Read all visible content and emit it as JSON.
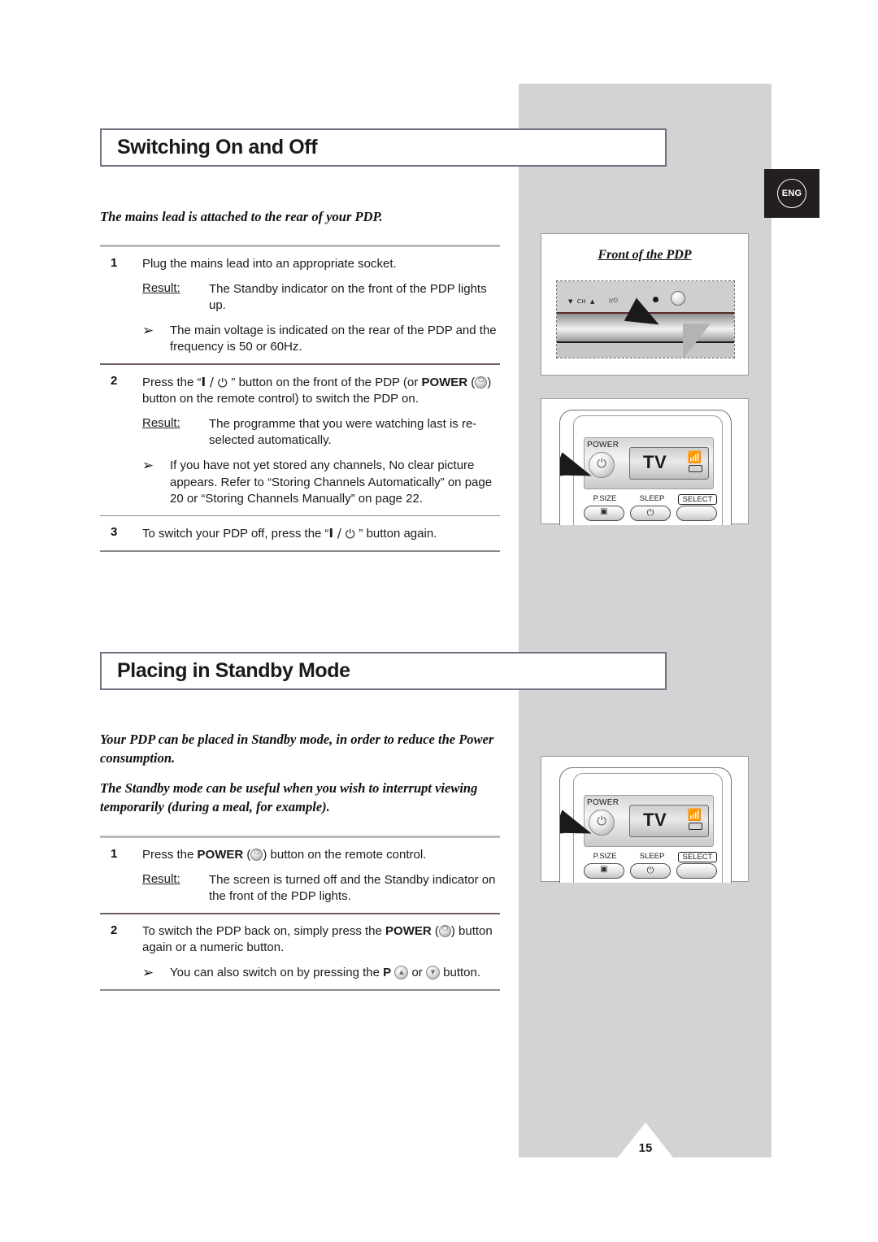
{
  "page": {
    "number": "15",
    "language_badge": "ENG"
  },
  "sections": [
    {
      "heading": "Switching On and Off",
      "intro": "The mains lead is attached to the rear of your PDP.",
      "steps": [
        {
          "num": "1",
          "text": "Plug the mains lead into an appropriate socket.",
          "result_label": "Result:",
          "result_text": "The Standby indicator on the front of the PDP lights up.",
          "note": "The main voltage is indicated on the rear of the PDP and the frequency is 50 or 60Hz."
        },
        {
          "num": "2",
          "text_a": "Press the “",
          "text_b": "” button on the front of the PDP (or ",
          "keyword": "POWER",
          "text_c": ") button on the remote control) to switch the PDP on.",
          "result_label": "Result:",
          "result_text": "The programme that you were watching last is re-selected automatically.",
          "note": "If you have not yet stored any channels, No clear picture appears. Refer to “Storing Channels Automatically” on page 20 or “Storing Channels Manually” on page 22."
        },
        {
          "num": "3",
          "text_a": "To switch your PDP off, press the “",
          "text_b": "” button again."
        }
      ]
    },
    {
      "heading": "Placing in Standby Mode",
      "intro_1": "Your PDP can be placed in Standby mode, in order to reduce the Power consumption.",
      "intro_2": "The Standby mode can be useful when you wish to interrupt viewing temporarily (during a meal, for example).",
      "steps": [
        {
          "num": "1",
          "text_a": "Press the ",
          "keyword": "POWER",
          "text_b": ") button on the remote control.",
          "result_label": "Result:",
          "result_text": "The screen is turned off and the Standby indicator on the front of the PDP lights."
        },
        {
          "num": "2",
          "text_a": "To switch the PDP back on, simply press the ",
          "keyword": "POWER",
          "text_b": ") button again or a numeric button.",
          "note_a": "You can also switch on by pressing the ",
          "note_keyword": "P",
          "note_b": " or ",
          "note_c": " button."
        }
      ]
    }
  ],
  "figures": {
    "front_of_pdp": {
      "title": "Front of the PDP",
      "controls": {
        "down_arrow": "▼",
        "ch_label": "CH",
        "up_arrow": "▲",
        "power_label": "I/⏻"
      }
    },
    "remote": {
      "power_label": "POWER",
      "display_text": "TV",
      "keys": [
        {
          "label": "P.SIZE",
          "glyph": "▣"
        },
        {
          "label": "SLEEP",
          "glyph": "⏻"
        },
        {
          "label": "SELECT",
          "glyph": ""
        }
      ]
    }
  },
  "glyphs": {
    "io_bar": "I",
    "io_slash": "/",
    "io_power": "⏻",
    "note_arrow": "➢",
    "quote_open": "“",
    "quote_close": "”",
    "paren_open": " ("
  }
}
